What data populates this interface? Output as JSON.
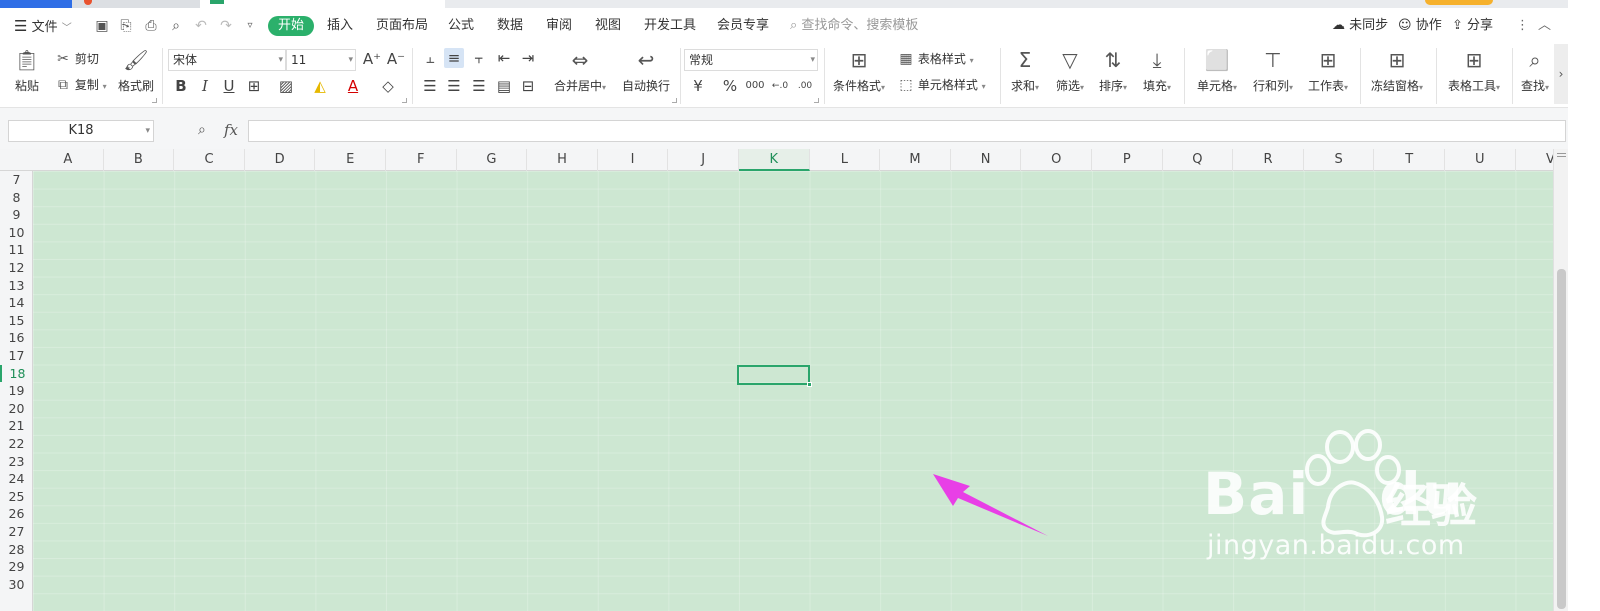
{
  "menubar": {
    "file": "文件",
    "tabs": [
      "开始",
      "插入",
      "页面布局",
      "公式",
      "数据",
      "审阅",
      "视图",
      "开发工具",
      "会员专享"
    ],
    "search_placeholder": "查找命令、搜索模板",
    "sync": "未同步",
    "collab": "协作",
    "share": "分享"
  },
  "ribbon": {
    "paste": "粘贴",
    "cut": "剪切",
    "copy": "复制",
    "format_painter": "格式刷",
    "font_name": "宋体",
    "font_size": "11",
    "merge_center": "合并居中",
    "wrap_text": "自动换行",
    "number_format": "常规",
    "conditional_format": "条件格式",
    "table_style": "表格样式",
    "cell_style": "单元格样式",
    "sum": "求和",
    "filter": "筛选",
    "sort": "排序",
    "fill": "填充",
    "cells": "单元格",
    "rows_cols": "行和列",
    "worksheet": "工作表",
    "freeze_panes": "冻结窗格",
    "table_tools": "表格工具",
    "find": "查找"
  },
  "formula_bar": {
    "name_box": "K18",
    "fx": "fx"
  },
  "grid": {
    "columns": [
      "A",
      "B",
      "C",
      "D",
      "E",
      "F",
      "G",
      "H",
      "I",
      "J",
      "K",
      "L",
      "M",
      "N",
      "O",
      "P",
      "Q",
      "R",
      "S",
      "T",
      "U",
      "V"
    ],
    "selected_column": "K",
    "rows": [
      "7",
      "8",
      "9",
      "10",
      "11",
      "12",
      "13",
      "14",
      "15",
      "16",
      "17",
      "18",
      "19",
      "20",
      "21",
      "22",
      "23",
      "24",
      "25",
      "26",
      "27",
      "28",
      "29",
      "30"
    ],
    "selected_row": "18",
    "cell_fill_color": "#cde7d2"
  },
  "colors": {
    "accent": "#2bb06b",
    "annotation_arrow": "#e83fe6"
  },
  "watermark": {
    "brand": "Bai",
    "brand2": "du",
    "cn": "经验",
    "url": "jingyan.baidu.com"
  }
}
